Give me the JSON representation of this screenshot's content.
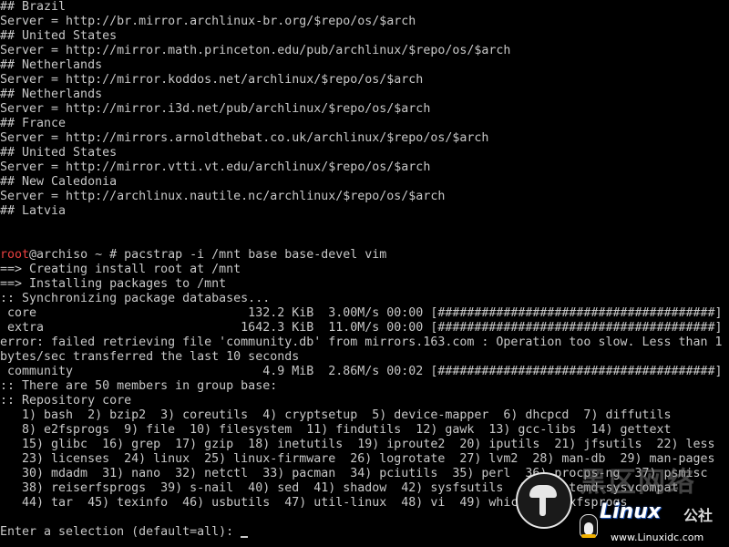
{
  "terminal": {
    "lines": [
      "## Brazil",
      "Server = http://br.mirror.archlinux-br.org/$repo/os/$arch",
      "## United States",
      "Server = http://mirror.math.princeton.edu/pub/archlinux/$repo/os/$arch",
      "## Netherlands",
      "Server = http://mirror.koddos.net/archlinux/$repo/os/$arch",
      "## Netherlands",
      "Server = http://mirror.i3d.net/pub/archlinux/$repo/os/$arch",
      "## France",
      "Server = http://mirrors.arnoldthebat.co.uk/archlinux/$repo/os/$arch",
      "## United States",
      "Server = http://mirror.vtti.vt.edu/archlinux/$repo/os/$arch",
      "## New Caledonia",
      "Server = http://archlinux.nautile.nc/archlinux/$repo/os/$arch",
      "## Latvia",
      "",
      "",
      "",
      "==> Creating install root at /mnt",
      "==> Installing packages to /mnt",
      ":: Synchronizing package databases...",
      " core                             132.2 KiB  3.00M/s 00:00 [######################################] 100%",
      " extra                           1642.3 KiB  11.0M/s 00:00 [######################################] 100%",
      "error: failed retrieving file 'community.db' from mirrors.163.com : Operation too slow. Less than 1",
      "bytes/sec transferred the last 10 seconds",
      " community                          4.9 MiB  2.86M/s 00:02 [######################################] 100%",
      ":: There are 50 members in group base:",
      ":: Repository core",
      "   1) bash  2) bzip2  3) coreutils  4) cryptsetup  5) device-mapper  6) dhcpcd  7) diffutils",
      "   8) e2fsprogs  9) file  10) filesystem  11) findutils  12) gawk  13) gcc-libs  14) gettext",
      "   15) glibc  16) grep  17) gzip  18) inetutils  19) iproute2  20) iputils  21) jfsutils  22) less",
      "   23) licenses  24) linux  25) linux-firmware  26) logrotate  27) lvm2  28) man-db  29) man-pages",
      "   30) mdadm  31) nano  32) netctl  33) pacman  34) pciutils  35) perl  36) procps-ng  37) psmisc",
      "   38) reiserfsprogs  39) s-nail  40) sed  41) shadow  42) sysfsutils  43) systemd-sysvcompat",
      "   44) tar  45) texinfo  46) usbutils  47) util-linux  48) vi  49) which  50) xfsprogs",
      ""
    ],
    "prompt": {
      "user": "root",
      "host_path": "@archiso ~ # ",
      "command": "pacstrap -i /mnt base base-devel vim"
    },
    "input_prompt": "Enter a selection (default=all): "
  },
  "watermark": {
    "cn_title": "黑区网络",
    "brand": "Linux",
    "gongsi": "公社",
    "url": "www.Linuxidc.com"
  },
  "colors": {
    "background": "#000000",
    "text": "#c8c8c8",
    "root_user": "#e84040"
  }
}
